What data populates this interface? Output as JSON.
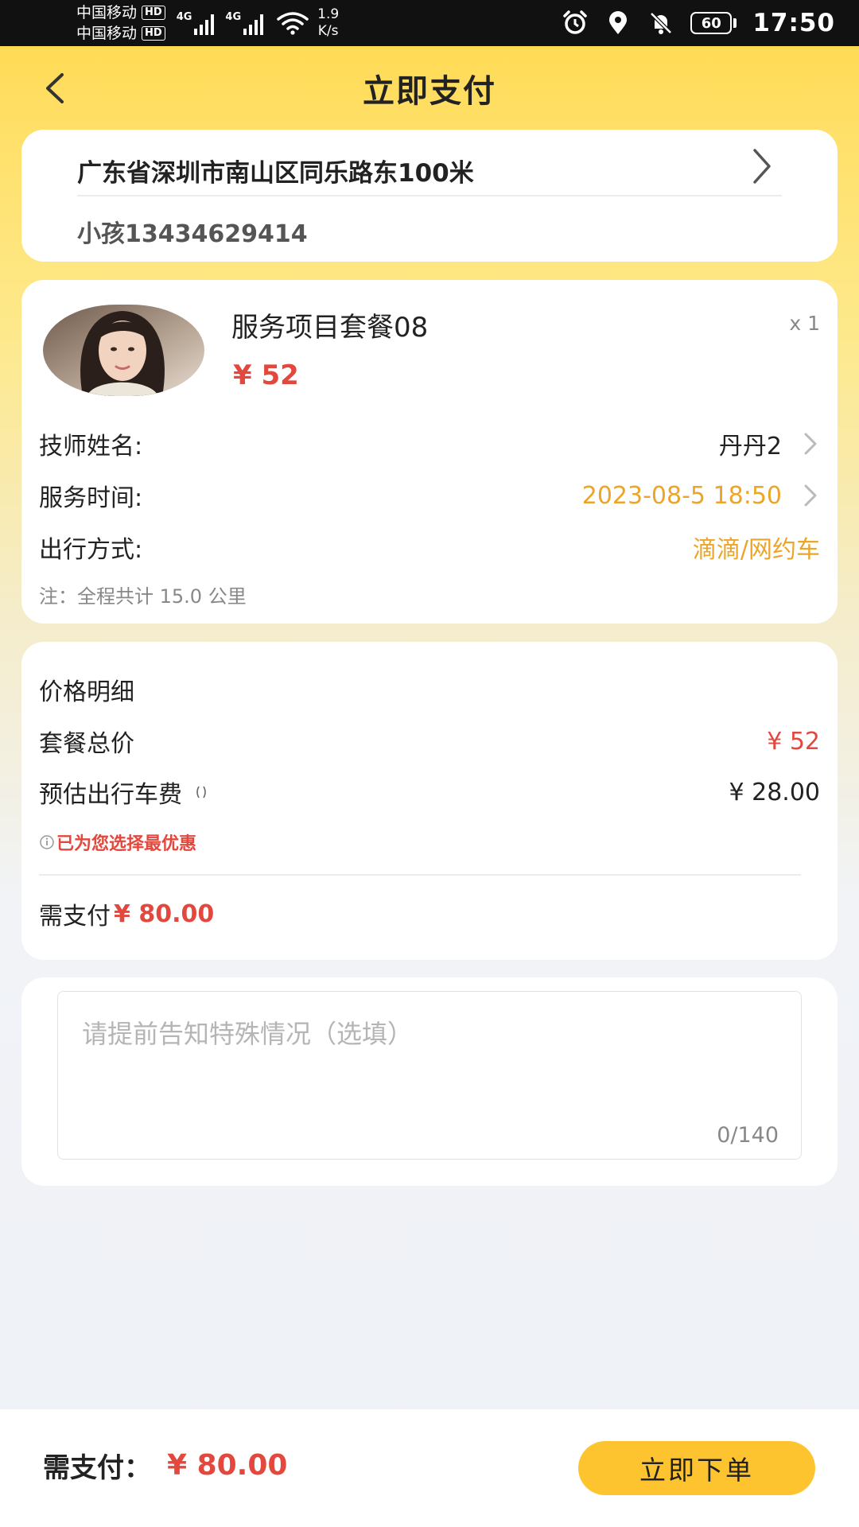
{
  "status_bar": {
    "carrier1": "中国移动",
    "carrier2": "中国移动",
    "hd1": "HD",
    "hd2": "HD",
    "network1": "4G",
    "network2": "4G",
    "speed_value": "1.9",
    "speed_unit": "K/s",
    "battery": "60",
    "time": "17:50",
    "icons": [
      "signal-icon",
      "wifi-icon",
      "alarm-icon",
      "location-icon",
      "mute-icon",
      "battery-icon"
    ]
  },
  "header": {
    "title": "立即支付"
  },
  "address": {
    "line": "广东省深圳市南山区同乐路东100米",
    "contact": "小孩13434629414"
  },
  "service": {
    "name": "服务项目套餐08",
    "quantity": "x 1",
    "price": "¥ 52",
    "rows": [
      {
        "label": "技师姓名:",
        "value": "丹丹2"
      },
      {
        "label": "服务时间:",
        "value": "2023-08-5 18:50"
      },
      {
        "label": "出行方式:",
        "value": "滴滴/网约车"
      }
    ],
    "note": "注：全程共计 15.0 公里"
  },
  "price_detail": {
    "title": "价格明细",
    "package_label": "套餐总价",
    "package_value": "¥ 52",
    "fare_label": "预估出行车费",
    "fare_value": "¥ 28.00",
    "tip": "已为您选择最优惠",
    "total_label": "需支付",
    "total_value": "¥ 80.00"
  },
  "remark": {
    "placeholder": "请提前告知特殊情况（选填）",
    "value": "",
    "counter": "0/140"
  },
  "bottom_bar": {
    "label": "需支付：",
    "amount": "¥ 80.00",
    "button": "立即下单"
  },
  "colors": {
    "primary_yellow": "#fec42f",
    "price_red": "#e2483d",
    "accent_orange": "#eba52a"
  }
}
